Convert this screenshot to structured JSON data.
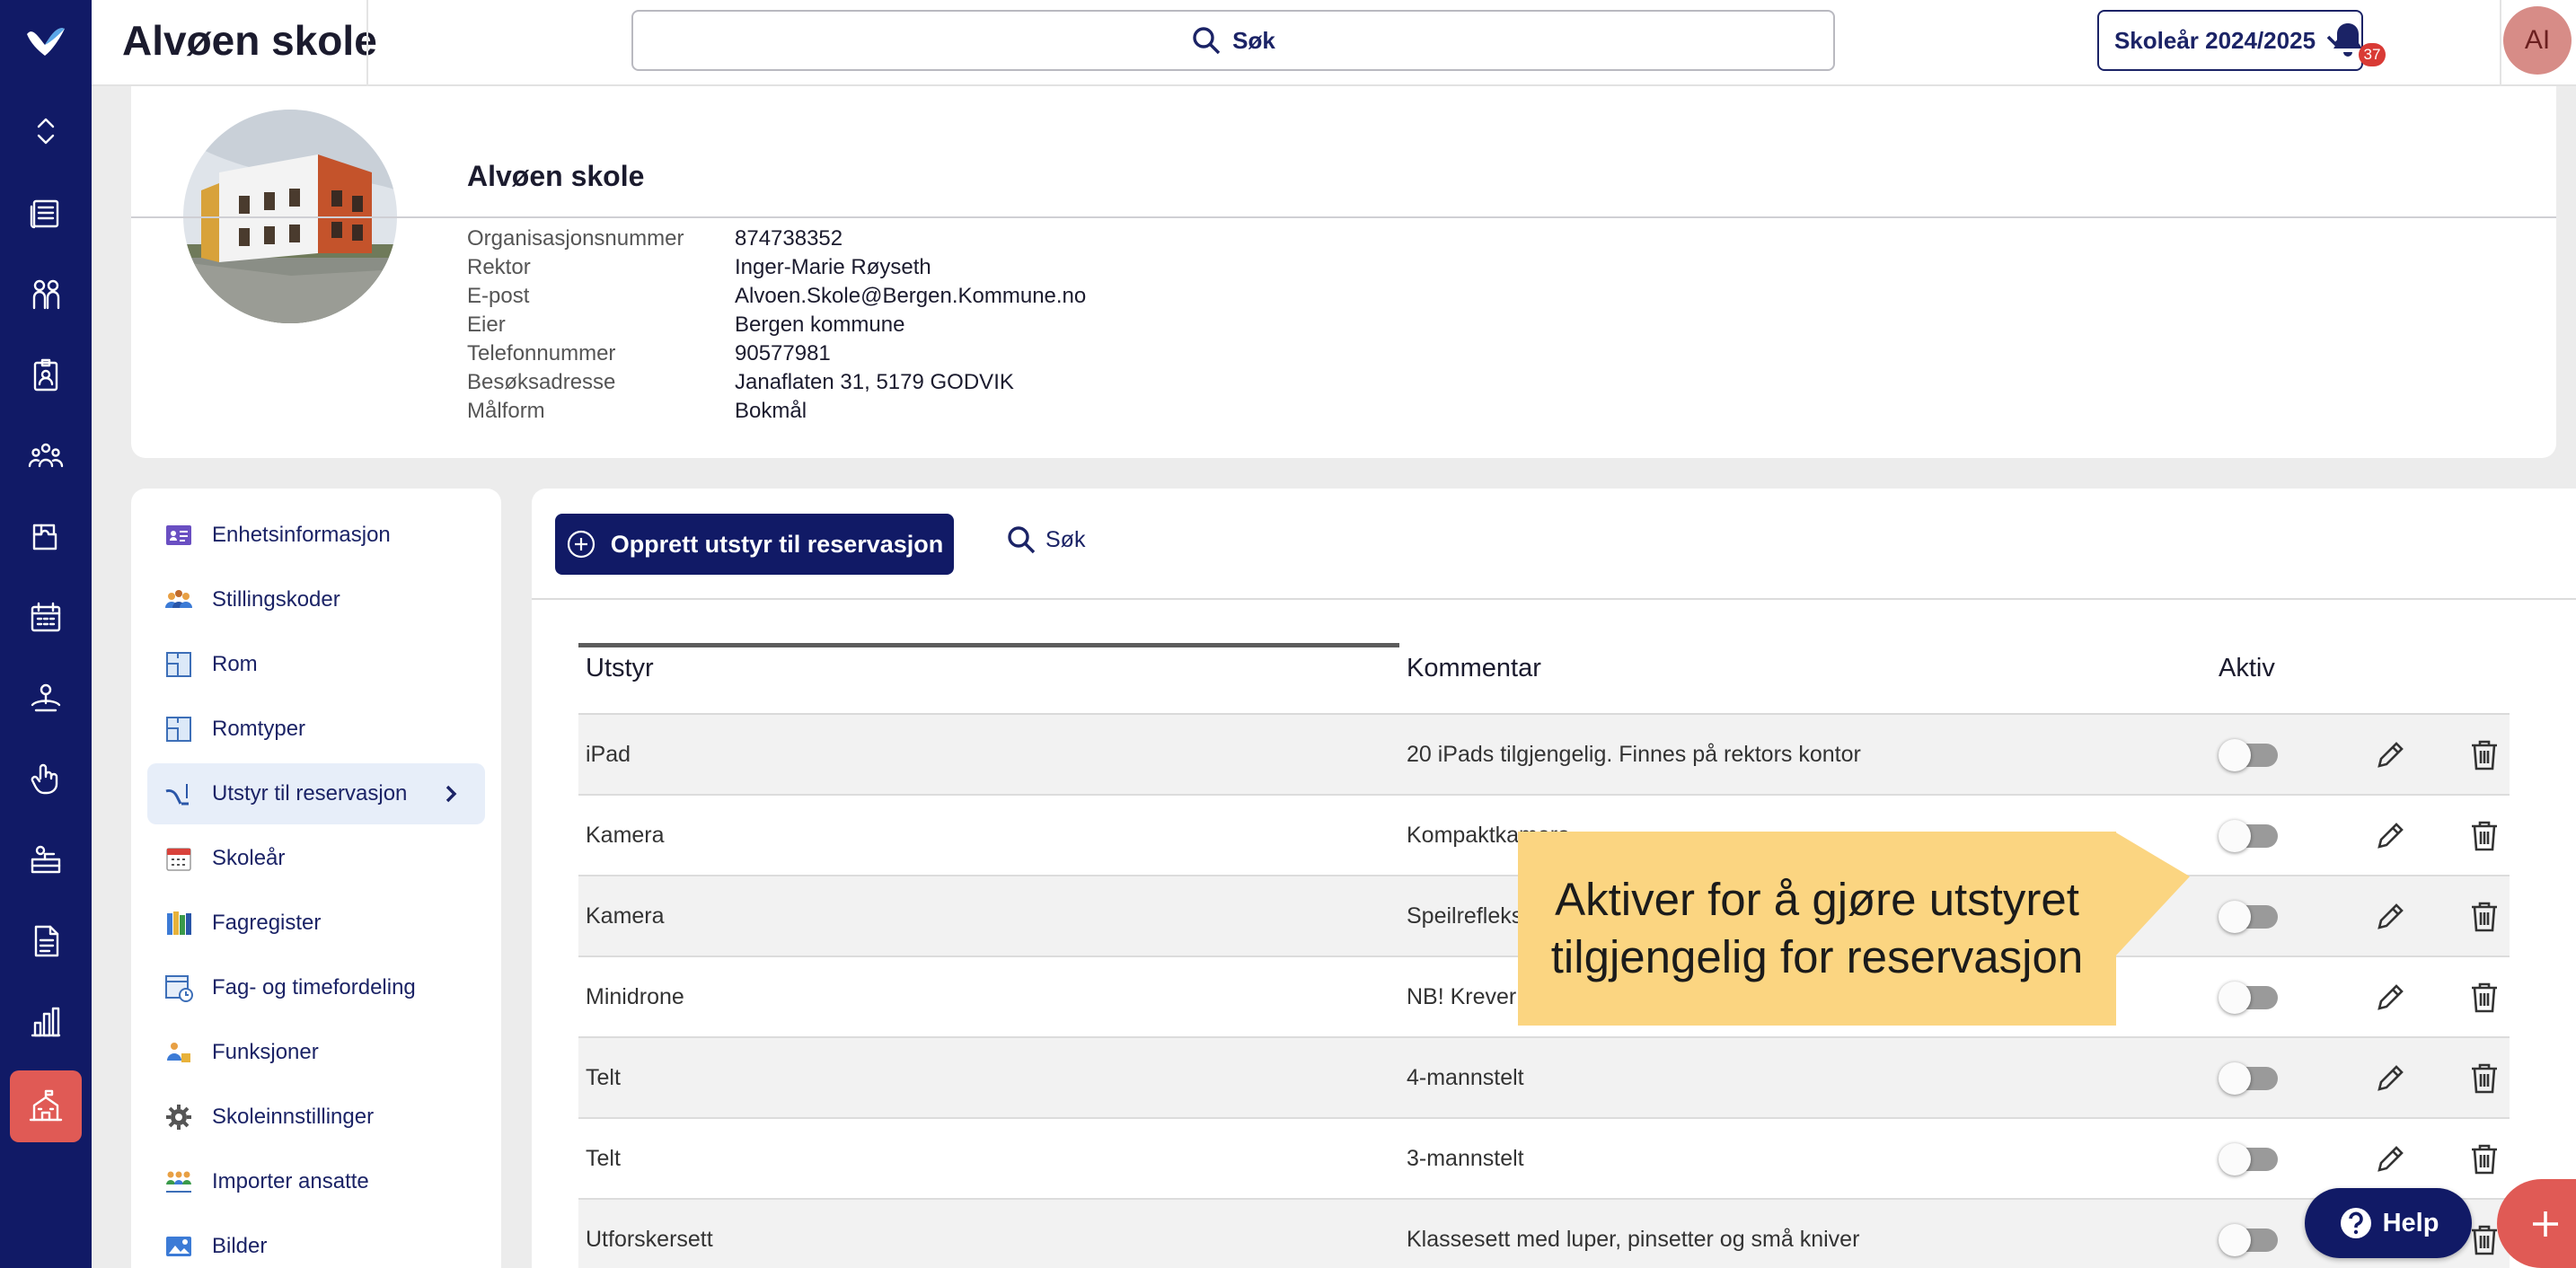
{
  "app": {
    "title": "Alvøen skole"
  },
  "topbar": {
    "search_label": "Søk",
    "school_year_label": "Skoleår 2024/2025",
    "notification_count": "37",
    "avatar_initials": "AI"
  },
  "rail": {
    "icons": [
      "expand-icon",
      "news-icon",
      "people-icon",
      "badge-icon",
      "groups-icon",
      "puzzle-icon",
      "calendar-grid-icon",
      "person-lift-icon",
      "raised-hand-icon",
      "desk-icon",
      "document-icon",
      "bar-chart-icon",
      "school-icon"
    ],
    "active": "school-icon"
  },
  "school": {
    "name": "Alvøen skole",
    "info": [
      {
        "label": "Organisasjonsnummer",
        "value": "874738352"
      },
      {
        "label": "Rektor",
        "value": "Inger-Marie Røyseth"
      },
      {
        "label": "E-post",
        "value": "Alvoen.Skole@Bergen.Kommune.no"
      },
      {
        "label": "Eier",
        "value": "Bergen kommune"
      },
      {
        "label": "Telefonnummer",
        "value": "90577981"
      },
      {
        "label": "Besøksadresse",
        "value": "Janaflaten 31, 5179 GODVIK"
      },
      {
        "label": "Målform",
        "value": "Bokmål"
      }
    ]
  },
  "sidenav": {
    "items": [
      {
        "label": "Enhetsinformasjon",
        "icon": "id-card-icon"
      },
      {
        "label": "Stillingskoder",
        "icon": "staff-group-icon"
      },
      {
        "label": "Rom",
        "icon": "floorplan-icon"
      },
      {
        "label": "Romtyper",
        "icon": "floorplan-icon"
      },
      {
        "label": "Utstyr til reservasjon",
        "icon": "equipment-icon",
        "active": true
      },
      {
        "label": "Skoleår",
        "icon": "calendar-icon"
      },
      {
        "label": "Fagregister",
        "icon": "books-icon"
      },
      {
        "label": "Fag- og timefordeling",
        "icon": "schedule-icon"
      },
      {
        "label": "Funksjoner",
        "icon": "roles-icon"
      },
      {
        "label": "Skoleinnstillinger",
        "icon": "gear-icon"
      },
      {
        "label": "Importer ansatte",
        "icon": "import-people-icon"
      },
      {
        "label": "Bilder",
        "icon": "image-icon"
      }
    ]
  },
  "main": {
    "create_label": "Opprett utstyr til reservasjon",
    "search_label": "Søk",
    "columns": [
      "Utstyr",
      "Kommentar",
      "Aktiv"
    ],
    "rows": [
      {
        "utstyr": "iPad",
        "kommentar": "20 iPads tilgjengelig. Finnes på rektors kontor",
        "aktiv": false
      },
      {
        "utstyr": "Kamera",
        "kommentar": "Kompaktkamera",
        "aktiv": false
      },
      {
        "utstyr": "Kamera",
        "kommentar": "Speilrefleks, Canon",
        "aktiv": false
      },
      {
        "utstyr": "Minidrone",
        "kommentar": "NB! Krever tillatelse",
        "aktiv": false
      },
      {
        "utstyr": "Telt",
        "kommentar": "4-mannstelt",
        "aktiv": false
      },
      {
        "utstyr": "Telt",
        "kommentar": "3-mannstelt",
        "aktiv": false
      },
      {
        "utstyr": "Utforskersett",
        "kommentar": "Klassesett med luper, pinsetter og små kniver",
        "aktiv": false
      }
    ]
  },
  "tooltip": {
    "line1": "Aktiver for å gjøre utstyret",
    "line2": "tilgjengelig for reservasjon"
  },
  "help": {
    "label": "Help"
  },
  "colors": {
    "navy": "#111a66",
    "accent": "#e05a55",
    "tooltip": "#fbd581"
  }
}
